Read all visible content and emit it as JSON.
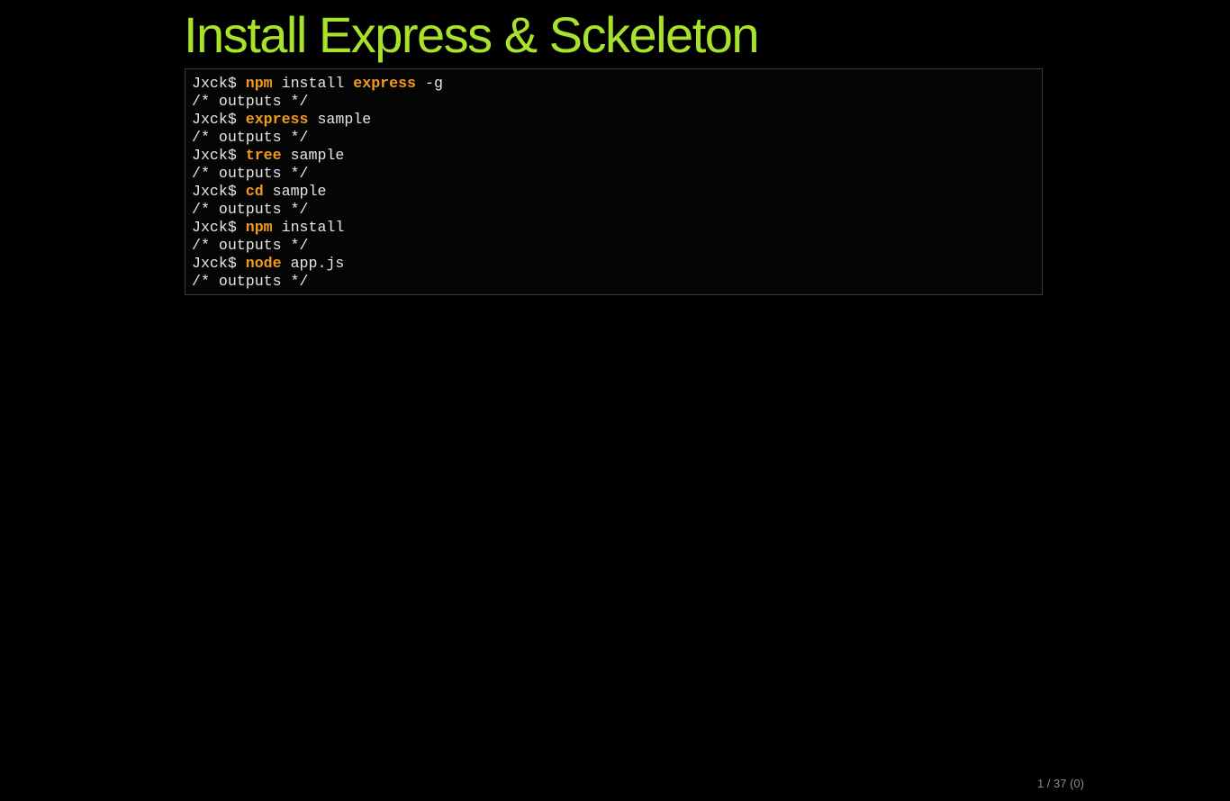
{
  "slide": {
    "title": "Install Express & Sckeleton",
    "page_indicator": "1 / 37 (0)"
  },
  "colors": {
    "background": "#000000",
    "title": "#a9e22a",
    "command_keyword": "#f29b1e",
    "code_text": "#e6e6e6",
    "counter": "#8c8c8c"
  },
  "terminal": {
    "lines": [
      {
        "prompt": "Jxck$",
        "cmd": "npm",
        "a1": "install",
        "kw2": "express",
        "a2": "-g"
      },
      {
        "text": "/* outputs */"
      },
      {
        "prompt": "Jxck$",
        "cmd": "express",
        "a1": "sample"
      },
      {
        "text": "/* outputs */"
      },
      {
        "prompt": "Jxck$",
        "cmd": "tree",
        "a1": "sample"
      },
      {
        "text": "/* outputs */"
      },
      {
        "prompt": "Jxck$",
        "cmd": "cd",
        "a1": "sample"
      },
      {
        "text": "/* outputs */"
      },
      {
        "prompt": "Jxck$",
        "cmd": "npm",
        "a1": "install"
      },
      {
        "text": "/* outputs */"
      },
      {
        "prompt": "Jxck$",
        "cmd": "node",
        "a1": "app.js"
      },
      {
        "text": "/* outputs */"
      }
    ]
  }
}
